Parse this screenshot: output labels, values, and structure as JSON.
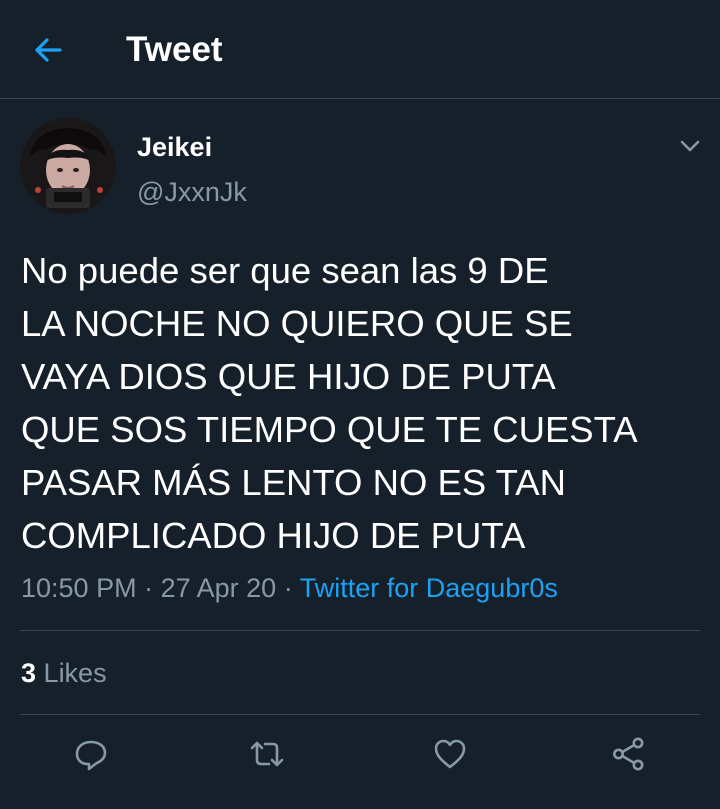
{
  "header": {
    "title": "Tweet"
  },
  "author": {
    "name": "Jeikei",
    "handle": "@JxxnJk"
  },
  "tweet": {
    "text": "No puede ser que sean las 9 DE\nLA NOCHE NO QUIERO QUE SE\nVAYA DIOS QUE HIJO DE PUTA\nQUE SOS TIEMPO QUE TE CUESTA\nPASAR MÁS LENTO NO ES TAN\nCOMPLICADO HIJO DE PUTA",
    "time": "10:50 PM",
    "date": "27 Apr 20",
    "separator": "·",
    "source": "Twitter for Daegubr0s"
  },
  "stats": {
    "likes_count": "3",
    "likes_label": "Likes"
  },
  "icons": {
    "back": "arrow-left-icon",
    "more": "chevron-down-icon",
    "reply": "reply-icon",
    "retweet": "retweet-icon",
    "like": "heart-icon",
    "share": "share-icon"
  },
  "colors": {
    "background": "#15202b",
    "accent": "#1da1f2",
    "secondary_text": "#8899a6",
    "divider": "#38444d"
  }
}
